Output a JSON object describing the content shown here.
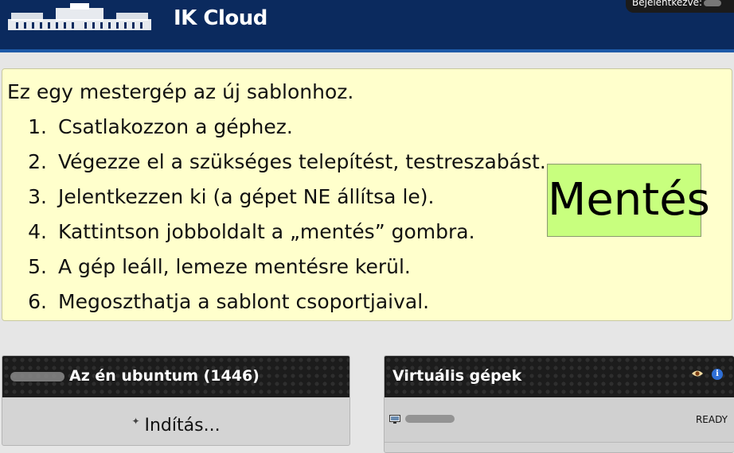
{
  "header": {
    "brand": "IK Cloud",
    "login_text": "Bejelentkezve:"
  },
  "notice": {
    "title": "Ez egy mestergép az új sablonhoz.",
    "steps": [
      {
        "num": "1.",
        "text": "Csatlakozzon a géphez."
      },
      {
        "num": "2.",
        "text": "Végezze el a szükséges telepítést, testreszabást."
      },
      {
        "num": "3.",
        "text": "Jelentkezzen ki (a gépet NE állítsa le)."
      },
      {
        "num": "4.",
        "text": "Kattintson jobboldalt a „mentés” gombra."
      },
      {
        "num": "5.",
        "text": "A gép leáll, lemeze mentésre kerül."
      },
      {
        "num": "6.",
        "text": "Megoszthatja a sablont csoportjaival."
      }
    ],
    "save_label": "Mentés"
  },
  "left_panel": {
    "title": "Az én ubuntum (1446)",
    "start_label": "Indítás..."
  },
  "right_panel": {
    "title": "Virtuális gépek",
    "vm_status": "READY"
  },
  "icons": {
    "logo": "university-building-logo",
    "eye": "eye-icon",
    "info": "info-icon",
    "monitor": "monitor-icon",
    "spinner": "spinner-icon"
  },
  "colors": {
    "header_bg": "#0b2a5e",
    "notice_bg": "#ffffcc",
    "save_button_bg": "#c8ff7e",
    "panel_head_bg": "#1c1c1c"
  }
}
